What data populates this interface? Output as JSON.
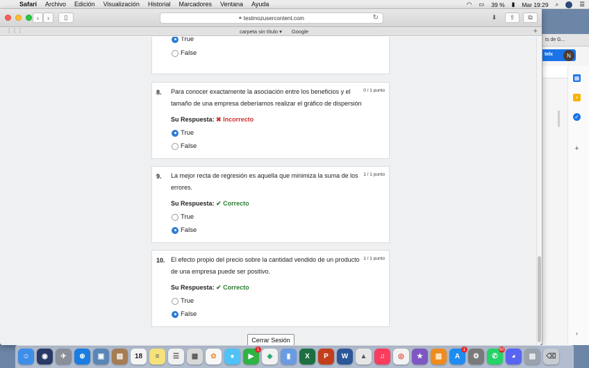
{
  "menubar": {
    "app": "Safari",
    "menus": [
      "Archivo",
      "Edición",
      "Visualización",
      "Historial",
      "Marcadores",
      "Ventana",
      "Ayuda"
    ],
    "battery": "39 %",
    "clock": "Mar 19:29"
  },
  "browser": {
    "url": "testmozusercontent.com",
    "favorites": [
      "carpeta sin título ▾",
      "Google"
    ]
  },
  "quiz": {
    "prev_options": [
      "True",
      "False"
    ],
    "questions": [
      {
        "number": "8.",
        "text": "Para conocer exactamente la asociación entre los beneficios y el tamaño de una empresa deberíamos realizar el gráfico de dispersión",
        "points": "0 / 1 punto",
        "answer_label": "Su Respuesta:",
        "result_icon": "✖",
        "result": "Incorrecto",
        "options": [
          "True",
          "False"
        ]
      },
      {
        "number": "9.",
        "text": "La mejor recta de regresión es aquella que minimiza la suma de los errores.",
        "points": "1 / 1 punto",
        "answer_label": "Su Respuesta:",
        "result_icon": "✔",
        "result": "Correcto",
        "options": [
          "True",
          "False"
        ]
      },
      {
        "number": "10.",
        "text": "El efecto propio del precio sobre la cantidad vendido de un producto de una empresa puede ser positivo.",
        "points": "1 / 1 punto",
        "answer_label": "Su Respuesta:",
        "result_icon": "✔",
        "result": "Correcto",
        "options": [
          "True",
          "False"
        ]
      }
    ],
    "logout_label": "Cerrar Sesión"
  },
  "background_window": {
    "tab_title": "ts de G...",
    "button": "telx",
    "avatar": "N"
  },
  "dock": {
    "calendar_day": "18",
    "badges": {
      "facetime": "1",
      "appstore": "1",
      "whatsapp": "60"
    }
  },
  "colors": {
    "correct": "#2e7d32",
    "incorrect": "#d32f2f",
    "radio_selected": "#2d7dd2"
  }
}
